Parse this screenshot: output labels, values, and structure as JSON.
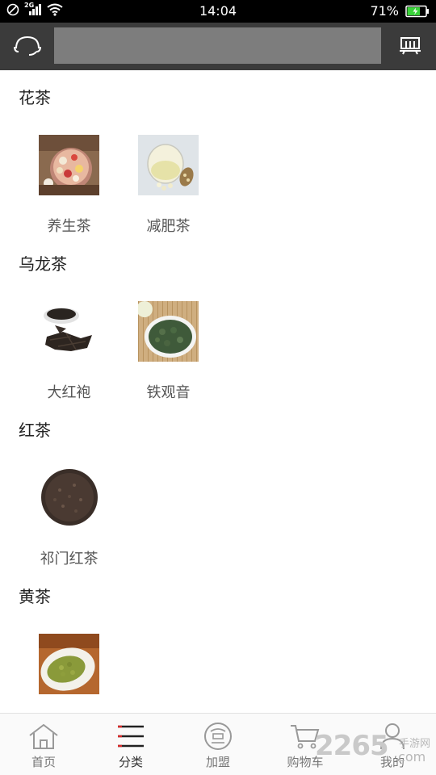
{
  "status_bar": {
    "time": "14:04",
    "network": "2G",
    "battery_percent": "71%",
    "battery_level": 0.71
  },
  "toolbar": {
    "search_value": "",
    "support_icon": "headset-icon",
    "scan_icon": "scan-icon"
  },
  "sections": [
    {
      "title": "花茶",
      "items": [
        {
          "label": "养生茶",
          "image": "flower-tea-cup-photo"
        },
        {
          "label": "减肥茶",
          "image": "glass-tea-cup-photo"
        }
      ]
    },
    {
      "title": "乌龙茶",
      "items": [
        {
          "label": "大红袍",
          "image": "dark-oolong-leaves-photo"
        },
        {
          "label": "铁观音",
          "image": "green-oolong-bowl-photo"
        }
      ]
    },
    {
      "title": "红茶",
      "items": [
        {
          "label": "祁门红茶",
          "image": "black-tea-pile-photo"
        }
      ]
    },
    {
      "title": "黄茶",
      "items": [
        {
          "label": "",
          "image": "yellow-tea-plate-photo"
        }
      ]
    }
  ],
  "bottom_nav": [
    {
      "label": "首页",
      "icon": "home-icon",
      "active": false
    },
    {
      "label": "分类",
      "icon": "category-icon",
      "active": true
    },
    {
      "label": "加盟",
      "icon": "join-icon",
      "active": false
    },
    {
      "label": "购物车",
      "icon": "cart-icon",
      "active": false
    },
    {
      "label": "我的",
      "icon": "user-icon",
      "active": false
    }
  ],
  "watermark": {
    "number": "2265",
    "text": "手游网",
    "domain": ".com"
  },
  "colors": {
    "toolbar": "#3b3b3b",
    "search_box": "#7d7d7d",
    "battery": "#3ad33a"
  }
}
